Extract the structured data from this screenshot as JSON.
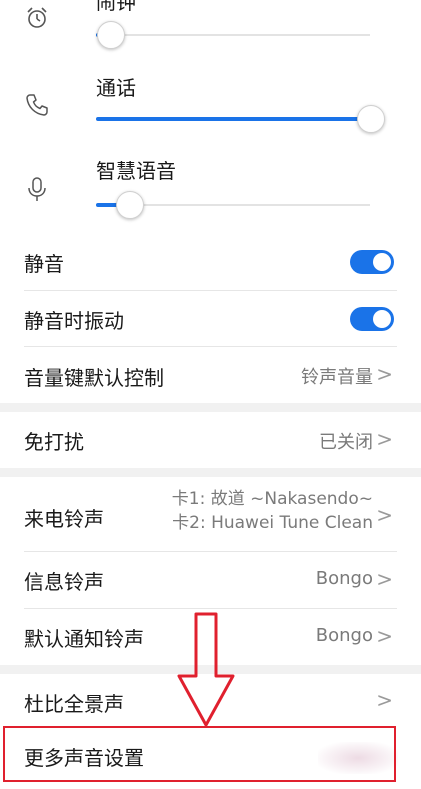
{
  "volume": {
    "alarm": {
      "label": "闹钟",
      "level": 0.05,
      "icon": "alarm-clock-icon"
    },
    "call": {
      "label": "通话",
      "level": 1.0,
      "icon": "phone-icon"
    },
    "assistant": {
      "label": "智慧语音",
      "level": 0.12,
      "icon": "microphone-icon"
    }
  },
  "settings": {
    "mute": {
      "label": "静音",
      "on": true
    },
    "vibrate_on_mute": {
      "label": "静音时振动",
      "on": true
    },
    "volume_key_default": {
      "label": "音量键默认控制",
      "value": "铃声音量"
    },
    "do_not_disturb": {
      "label": "免打扰",
      "value": "已关闭"
    },
    "ringtone": {
      "label": "来电铃声",
      "sim1": "卡1: 故道 ~Nakasendo~",
      "sim2": "卡2: Huawei Tune Clean"
    },
    "message_tone": {
      "label": "信息铃声",
      "value": "Bongo"
    },
    "notification_tone": {
      "label": "默认通知铃声",
      "value": "Bongo"
    },
    "dolby": {
      "label": "杜比全景声"
    },
    "more_sound": {
      "label": "更多声音设置"
    }
  },
  "chevron": ">",
  "colors": {
    "accent": "#1a73e8",
    "annotation_red": "#e0202e",
    "gap_bg": "#f1f1f1"
  }
}
